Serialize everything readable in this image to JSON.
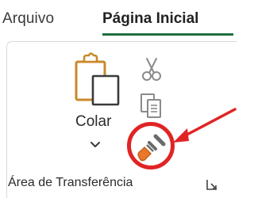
{
  "tabs": {
    "file": "Arquivo",
    "home": "Página Inicial"
  },
  "clipboard": {
    "paste_label": "Colar",
    "group_label": "Área de Transferência"
  },
  "icons": {
    "paste": "clipboard-paste-icon",
    "cut": "scissors-icon",
    "copy": "copy-icon",
    "format_painter": "paintbrush-icon",
    "dropdown": "chevron-down-icon",
    "launcher": "dialog-launcher-icon"
  },
  "colors": {
    "accent": "#1f6f3f",
    "paste_icon": "#c98a2a",
    "annotation": "#e02424",
    "painter_brush": "#e9782a"
  }
}
